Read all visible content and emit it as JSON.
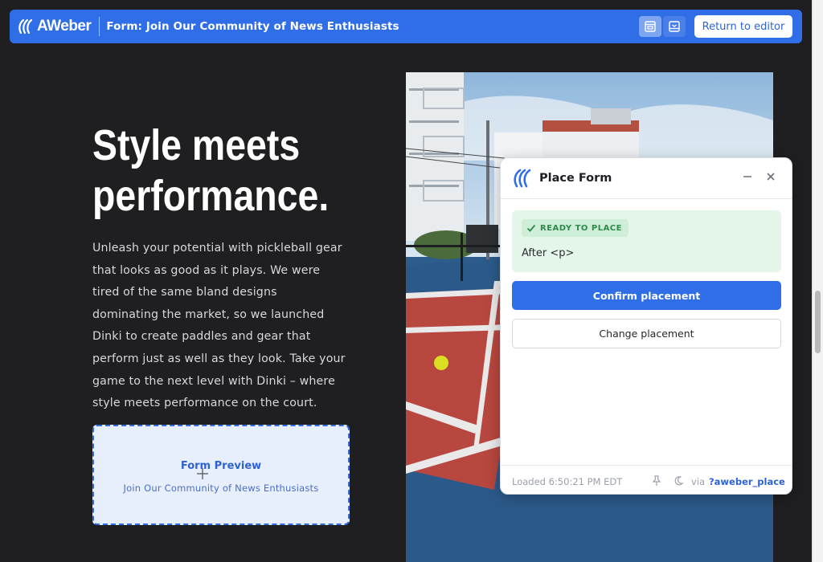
{
  "header": {
    "logo_text": "AWeber",
    "form_title": "Form: Join Our Community of News Enthusiasts",
    "return_label": "Return to editor",
    "view_icons": [
      "desktop-view-icon",
      "mobile-view-icon"
    ]
  },
  "hero": {
    "title_lines": [
      "Style meets",
      "performance."
    ],
    "body_lines": [
      "Unleash your potential with pickleball gear",
      "that looks as good as it plays. We were",
      "tired of the same bland designs",
      "dominating the market, so we launched",
      "Dinki to create paddles and gear that",
      "perform just as well as they look. Take your",
      "game to the next level with Dinki – where",
      "style meets performance on the court."
    ]
  },
  "form_preview": {
    "title": "Form Preview",
    "subtitle": "Join Our Community of News Enthusiasts"
  },
  "panel": {
    "title": "Place Form",
    "status_badge": "READY TO PLACE",
    "status_text": "After <p>",
    "confirm_label": "Confirm placement",
    "change_label": "Change placement",
    "footer_loaded": "Loaded 6:50:21 PM EDT",
    "footer_via": "via",
    "footer_param": "?aweber_place"
  },
  "colors": {
    "brand_blue": "#2f6ee6",
    "page_bg": "#1f1f21",
    "ready_green": "#2c8a4b",
    "ready_bg": "#e4f5e9"
  }
}
